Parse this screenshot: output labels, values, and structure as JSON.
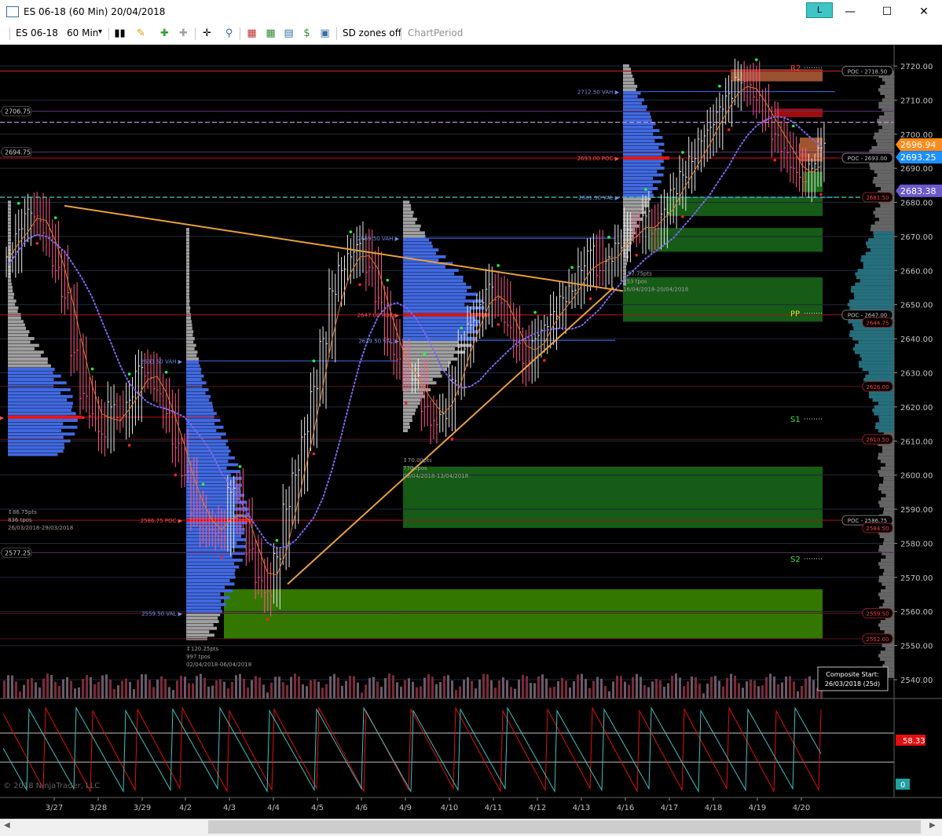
{
  "window": {
    "title": "ES 06-18 (60 Min)  20/04/2018",
    "link_label": "L",
    "minimize": "—",
    "maximize": "☐",
    "close": "✕"
  },
  "toolbar": {
    "instrument": "ES 06-18",
    "interval": "60 Min",
    "dropdown_arrow": "▾",
    "sd_zones": "SD zones off",
    "chart_period": "ChartPeriod",
    "icons": [
      "bars-icon",
      "pencil-icon",
      "add-indicator-icon",
      "strategy-icon",
      "crosshair-icon",
      "zoom-icon",
      "properties-icon",
      "data-box-icon",
      "chart-trader-icon",
      "money-icon",
      "template-icon"
    ]
  },
  "colors": {
    "background": "#000000",
    "grid": "#1f2a3a",
    "value_area": "#4169e1",
    "poc": "#ff1a1a",
    "outside_profile": "#a0a0a0",
    "zone_green": "#1a6b1a",
    "zone_light_green": "#3c8c00",
    "trend": "#e8a040",
    "ma_orange": "#e07a20",
    "ma_dots": "#7b68ee",
    "price_up": "#ff8c1a",
    "price_last": "#1e90ff",
    "price_mid": "#6a5acd"
  },
  "chart_data": {
    "type": "candlestick",
    "instrument": "ES 06-18",
    "period": "60 Min",
    "ylim": [
      2534,
      2725
    ],
    "y_ticks": [
      2540,
      2550,
      2560,
      2570,
      2580,
      2590,
      2600,
      2610,
      2620,
      2630,
      2640,
      2650,
      2660,
      2670,
      2680,
      2690,
      2700,
      2710,
      2720
    ],
    "x_labels": [
      "3/27",
      "3/28",
      "3/29",
      "4/2",
      "4/3",
      "4/4",
      "4/5",
      "4/6",
      "4/9",
      "4/10",
      "4/11",
      "4/12",
      "4/13",
      "4/16",
      "4/17",
      "4/18",
      "4/19",
      "4/20"
    ],
    "closes": [
      2664,
      2672,
      2678,
      2676,
      2670,
      2660,
      2652,
      2636,
      2624,
      2618,
      2612,
      2620,
      2616,
      2622,
      2632,
      2630,
      2625,
      2618,
      2608,
      2600,
      2590,
      2586,
      2584,
      2582,
      2595,
      2588,
      2578,
      2570,
      2566,
      2576,
      2590,
      2600,
      2612,
      2626,
      2640,
      2654,
      2660,
      2664,
      2668,
      2661,
      2652,
      2640,
      2634,
      2628,
      2628,
      2620,
      2616,
      2618,
      2628,
      2636,
      2644,
      2650,
      2656,
      2652,
      2644,
      2638,
      2632,
      2640,
      2644,
      2648,
      2652,
      2654,
      2660,
      2666,
      2660,
      2664,
      2668,
      2672,
      2670,
      2676,
      2672,
      2678,
      2684,
      2688,
      2692,
      2698,
      2702,
      2708,
      2712,
      2716,
      2714,
      2710,
      2704,
      2700,
      2696,
      2690,
      2686,
      2690,
      2696
    ],
    "profiles": [
      {
        "label_poc": "2617.00",
        "poc": 2617,
        "stats": [
          "↕86.75pts",
          "836 tpos",
          "26/03/2018-29/03/2018"
        ]
      },
      {
        "label_vah": "2633.50 VAH",
        "vah": 2633.5,
        "label_poc": "2586.75 POC",
        "poc": 2586.75,
        "label_val": "2559.50 VAL",
        "val": 2559.5,
        "stats": [
          "↕120.25pts",
          "997 tpos",
          "02/04/2018-06/04/2018"
        ]
      },
      {
        "label_vah": "2669.50 VAH",
        "vah": 2669.5,
        "label_poc": "2647.00 POC",
        "poc": 2647,
        "label_val": "2639.50 VAL",
        "val": 2639.5,
        "stats": [
          "↕70.00pts",
          "770 tpos",
          "09/04/2018-13/04/2018"
        ]
      },
      {
        "label_vah": "2712.50 VAH",
        "vah": 2712.5,
        "label_poc": "2693.00 POC",
        "poc": 2693,
        "label_val": "2681.50 VAL",
        "val": 2681.5,
        "stats": [
          "↕57.75pts",
          "653 tpos",
          "16/04/2018-20/04/2018"
        ]
      }
    ],
    "levels_left": [
      {
        "label": "2706.75",
        "y": 2706.75
      },
      {
        "label": "2694.75",
        "y": 2694.75
      },
      {
        "label": "2577.25",
        "y": 2577.25
      }
    ],
    "levels_right": [
      {
        "label": "POC - 2718.50",
        "y": 2718.5,
        "kind": "poc"
      },
      {
        "label": "POC - 2693.00",
        "y": 2693,
        "kind": "poc"
      },
      {
        "label": "2681.50",
        "y": 2681.5,
        "kind": "red"
      },
      {
        "label": "POC - 2647.00",
        "y": 2647,
        "kind": "poc"
      },
      {
        "label": "2644.75",
        "y": 2644.75,
        "kind": "red"
      },
      {
        "label": "2626.00",
        "y": 2626,
        "kind": "red"
      },
      {
        "label": "2610.50",
        "y": 2610.5,
        "kind": "red"
      },
      {
        "label": "POC - 2586.75",
        "y": 2586.75,
        "kind": "poc"
      },
      {
        "label": "2584.50",
        "y": 2584.5,
        "kind": "red"
      },
      {
        "label": "2559.50",
        "y": 2559.5,
        "kind": "red"
      },
      {
        "label": "2552.00",
        "y": 2552,
        "kind": "red"
      }
    ],
    "pivots": [
      {
        "label": "R2",
        "y": 2719.5
      },
      {
        "label": "PP",
        "y": 2647.5
      },
      {
        "label": "S1",
        "y": 2616.5
      },
      {
        "label": "S2",
        "y": 2575.5
      }
    ],
    "price_markers": [
      {
        "label": "2696.94",
        "y": 2696.94,
        "color": "#ff8c1a"
      },
      {
        "label": "2693.25",
        "y": 2693.25,
        "color": "#1e90ff"
      },
      {
        "label": "2683.38",
        "y": 2683.38,
        "color": "#6a5acd"
      }
    ],
    "zones": [
      {
        "from": 2552,
        "to": 2566.5,
        "color": "#3c8c00"
      },
      {
        "from": 2584.5,
        "to": 2602.5,
        "color": "#1a6b1a"
      },
      {
        "from": 2645,
        "to": 2658,
        "color": "#1a6b1a"
      },
      {
        "from": 2665.5,
        "to": 2672.5,
        "color": "#1a6b1a"
      },
      {
        "from": 2676,
        "to": 2681.5,
        "color": "#1a6b1a"
      }
    ],
    "composite": {
      "line1": "Composite Start:",
      "line2": "26/03/2018 (25d)"
    },
    "oscillator": {
      "value_red": "58.33",
      "value_cyan": "0"
    },
    "copyright": "© 2018 NinjaTrader, LLC"
  }
}
